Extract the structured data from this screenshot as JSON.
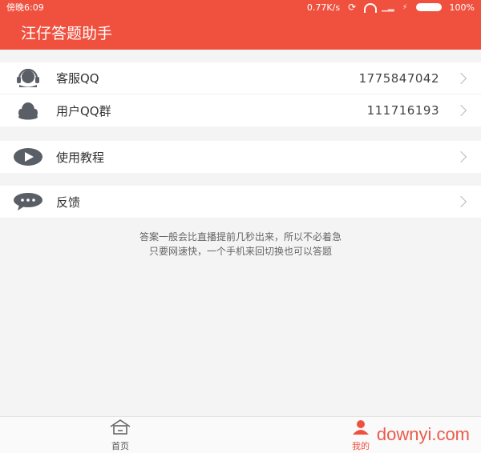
{
  "status_bar": {
    "time": "傍晚6:09",
    "speed": "0.77K/s",
    "battery": "100%"
  },
  "app_bar": {
    "title": "汪仔答题助手"
  },
  "contact_group": [
    {
      "icon": "headset-icon",
      "label": "客服QQ",
      "value": "1775847042"
    },
    {
      "icon": "qq-penguin-icon",
      "label": "用户QQ群",
      "value": "111716193"
    }
  ],
  "tutorial": {
    "icon": "play-icon",
    "label": "使用教程"
  },
  "feedback": {
    "icon": "chat-bubble-icon",
    "label": "反馈"
  },
  "tip": {
    "line1": "答案一般会比直播提前几秒出来，所以不必着急",
    "line2": "只要网速快，一个手机来回切换也可以答题"
  },
  "bottom_nav": {
    "home_label": "首页",
    "mine_label": "我的"
  },
  "watermark": "downyi.com",
  "colors": {
    "brand": "#f0513f",
    "icon": "#5a5e66"
  }
}
